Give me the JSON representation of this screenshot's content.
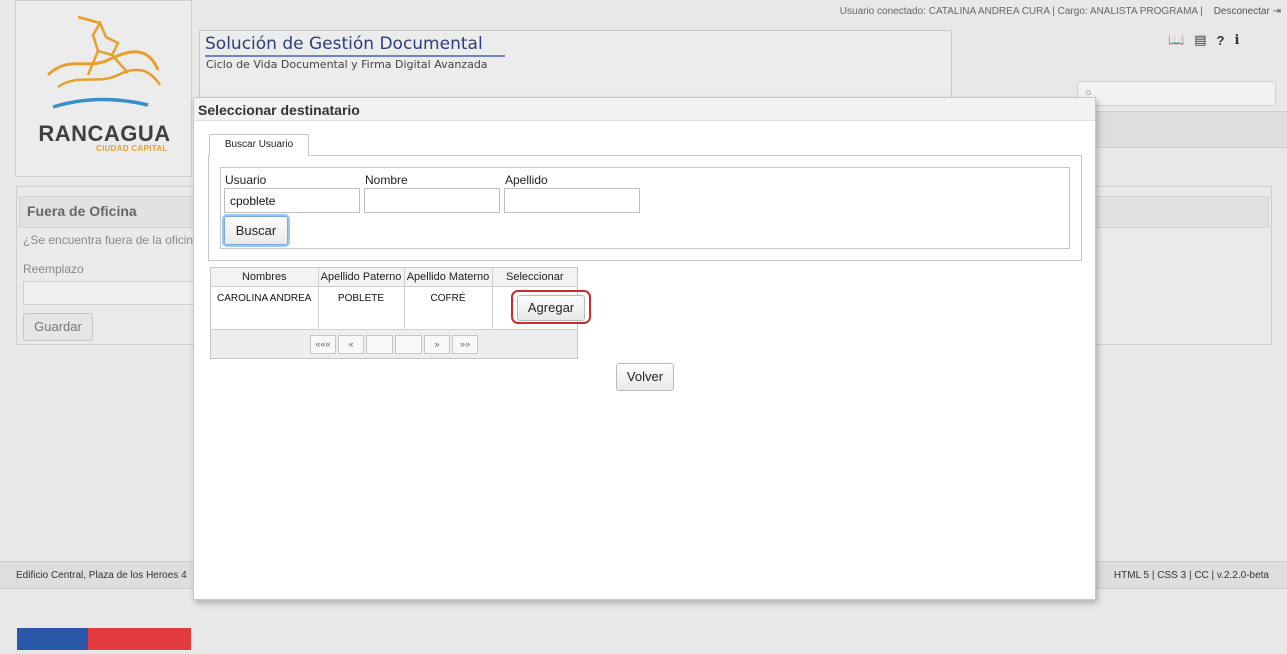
{
  "header": {
    "user_info": "Usuario conectado: CATALINA ANDREA CURA | Cargo: ANALISTA PROGRAMA |",
    "logout_label": "Desconectar",
    "app_title": "Solución de Gestión Documental",
    "app_subtitle": "Ciclo de Vida Documental y Firma Digital Avanzada",
    "logo_name": "RANCAGUA",
    "logo_sub": "CIUDAD CAPITAL",
    "help_glyph": "?",
    "info_glyph": "i"
  },
  "out_of_office": {
    "title": "Fuera de Oficina",
    "question": "¿Se encuentra fuera de la oficin",
    "replacement_label": "Reemplazo",
    "save_label": "Guardar"
  },
  "footer": {
    "left_text": "Edificio Central, Plaza de los Heroes 4",
    "right_text": "HTML 5 | CSS 3 | CC | v.2.2.0-beta"
  },
  "modal": {
    "title": "Seleccionar destinatario",
    "tab_label": "Buscar Usuario",
    "fields": {
      "usuario_label": "Usuario",
      "usuario_value": "cpoblete",
      "nombre_label": "Nombre",
      "nombre_value": "",
      "apellido_label": "Apellido",
      "apellido_value": ""
    },
    "search_label": "Buscar",
    "table": {
      "headers": [
        "Nombres",
        "Apellido Paterno",
        "Apellido Materno",
        "Seleccionar"
      ],
      "rows": [
        {
          "nombres": "CAROLINA ANDREA",
          "paterno": "POBLETE",
          "materno": "COFRÉ",
          "action": "Agregar"
        }
      ]
    },
    "pager": {
      "first": "«««",
      "prev": "«",
      "next": "»",
      "last": "»»"
    },
    "back_label": "Volver"
  },
  "colors": {
    "accent_title": "#2b3f7c",
    "highlight_border": "#cc2b2b",
    "flag_blue": "#2a57a8",
    "flag_red": "#e23a3f"
  }
}
